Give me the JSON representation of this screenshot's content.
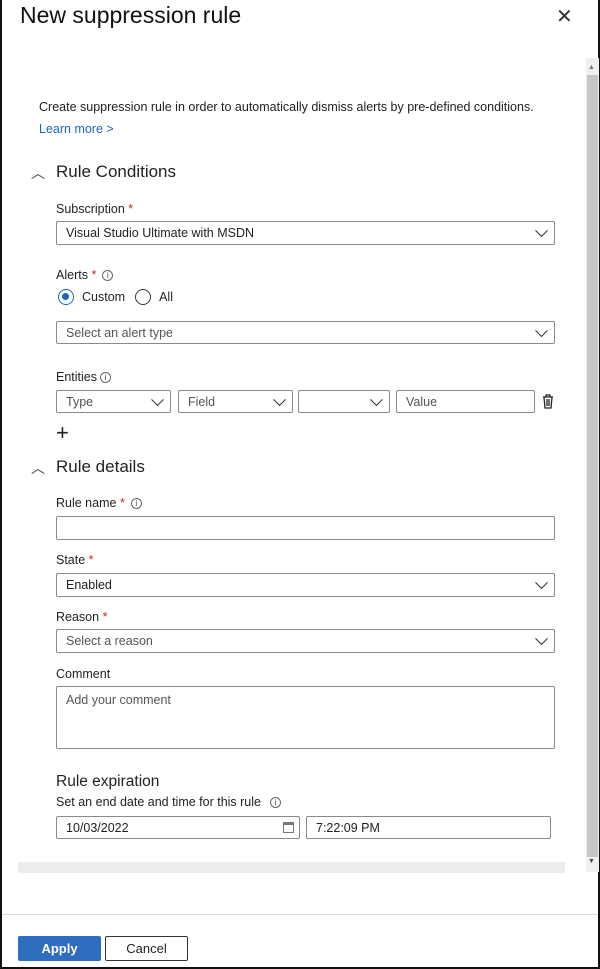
{
  "panel": {
    "title": "New suppression rule",
    "close_icon": "close-icon"
  },
  "intro": {
    "text": "Create suppression rule in order to automatically dismiss alerts by pre-defined conditions.",
    "learn_more": "Learn more >"
  },
  "conditions": {
    "heading": "Rule Conditions",
    "subscription": {
      "label": "Subscription",
      "required": "*",
      "value": "Visual Studio Ultimate with MSDN"
    },
    "alerts": {
      "label": "Alerts",
      "required": "*",
      "options": [
        "Custom",
        "All"
      ],
      "selected": "Custom",
      "select_placeholder": "Select an alert type"
    },
    "entities": {
      "label": "Entities",
      "type_placeholder": "Type",
      "field_placeholder": "Field",
      "operator_value": "",
      "value_placeholder": "Value",
      "add_label": "+"
    }
  },
  "details": {
    "heading": "Rule details",
    "rule_name": {
      "label": "Rule name",
      "required": "*",
      "value": ""
    },
    "state": {
      "label": "State",
      "required": "*",
      "value": "Enabled"
    },
    "reason": {
      "label": "Reason",
      "required": "*",
      "placeholder": "Select a reason"
    },
    "comment": {
      "label": "Comment",
      "placeholder": "Add your comment"
    }
  },
  "expiration": {
    "heading": "Rule expiration",
    "subtitle": "Set an end date and time for this rule",
    "date": "10/03/2022",
    "time": "7:22:09 PM"
  },
  "footer": {
    "apply": "Apply",
    "cancel": "Cancel"
  },
  "colors": {
    "accent": "#2f6ebf",
    "link": "#1a65c0",
    "required": "#c4262e"
  }
}
